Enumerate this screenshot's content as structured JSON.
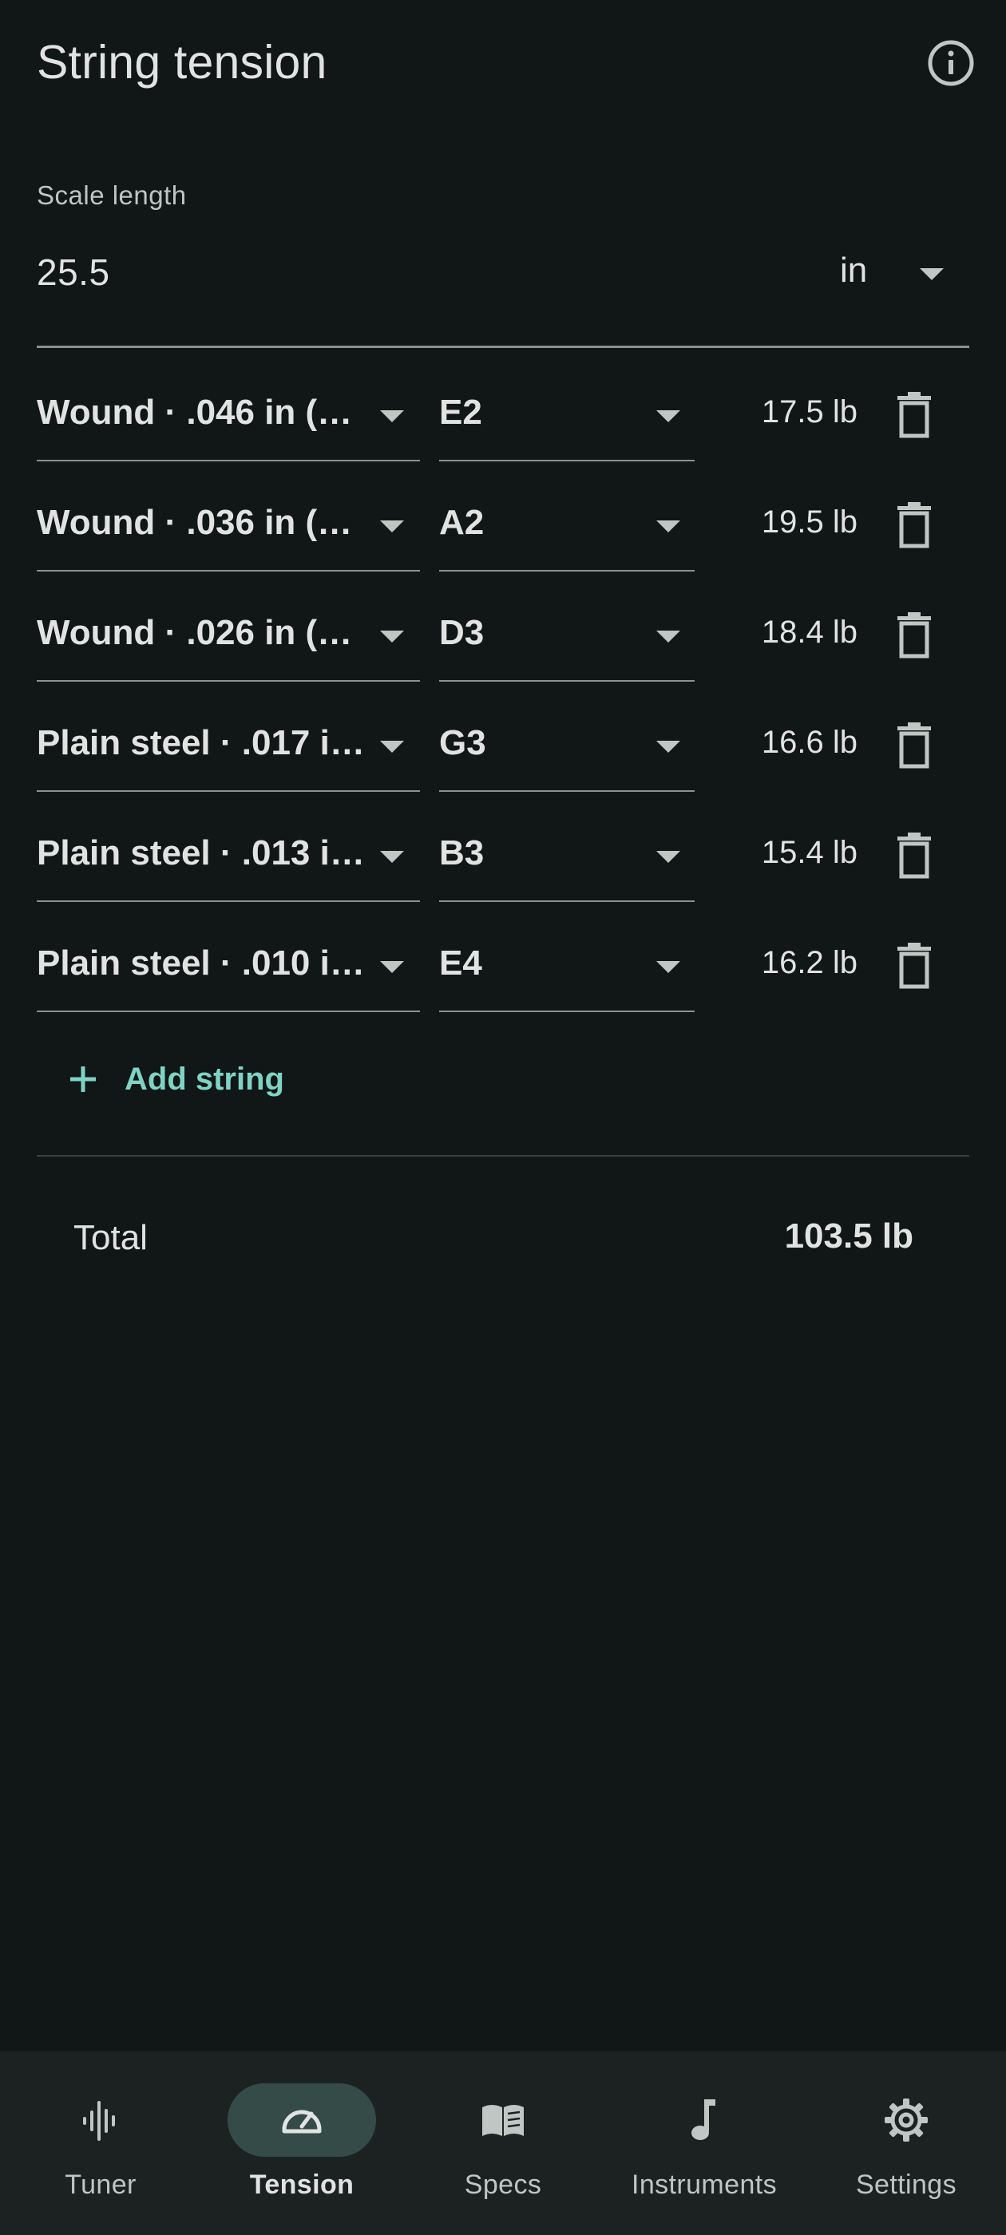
{
  "header": {
    "title": "String tension",
    "info_icon": "info-circle-icon"
  },
  "scale": {
    "label": "Scale length",
    "value": "25.5",
    "unit": "in"
  },
  "strings": [
    {
      "gauge": "Wound · .046 in (…",
      "note": "E2",
      "tension": "17.5 lb"
    },
    {
      "gauge": "Wound · .036 in (…",
      "note": "A2",
      "tension": "19.5 lb"
    },
    {
      "gauge": "Wound · .026 in (…",
      "note": "D3",
      "tension": "18.4 lb"
    },
    {
      "gauge": "Plain steel · .017 i…",
      "note": "G3",
      "tension": "16.6 lb"
    },
    {
      "gauge": "Plain steel · .013 i…",
      "note": "B3",
      "tension": "15.4 lb"
    },
    {
      "gauge": "Plain steel · .010 i…",
      "note": "E4",
      "tension": "16.2 lb"
    }
  ],
  "add_string": {
    "label": "Add string"
  },
  "total": {
    "label": "Total",
    "value": "103.5 lb"
  },
  "nav": {
    "items": [
      {
        "label": "Tuner",
        "icon": "waveform-icon",
        "active": false
      },
      {
        "label": "Tension",
        "icon": "gauge-icon",
        "active": true
      },
      {
        "label": "Specs",
        "icon": "book-icon",
        "active": false
      },
      {
        "label": "Instruments",
        "icon": "music-note-icon",
        "active": false
      },
      {
        "label": "Settings",
        "icon": "gear-icon",
        "active": false
      }
    ]
  },
  "colors": {
    "background": "#111616",
    "accent": "#80d3c4",
    "nav_background": "#1c2222",
    "nav_active_pill": "#344b47"
  }
}
